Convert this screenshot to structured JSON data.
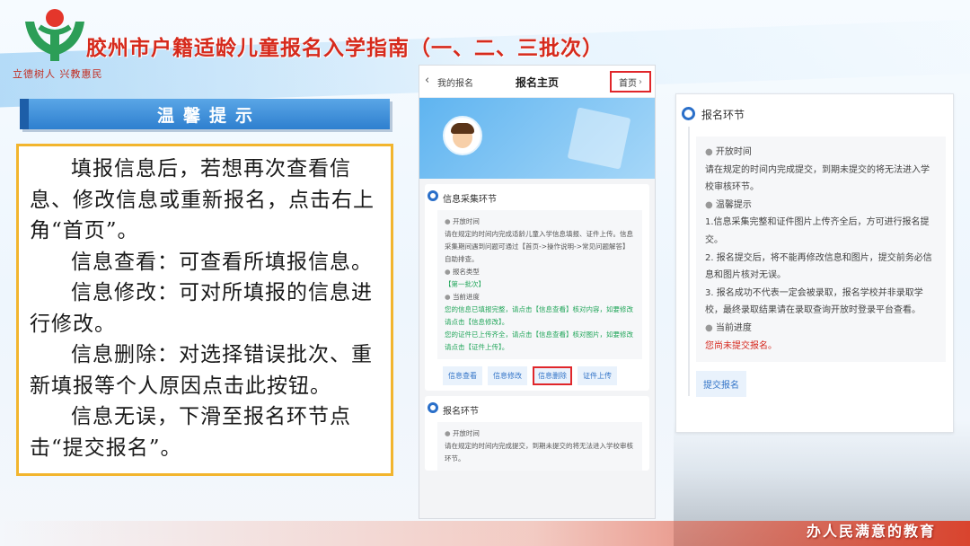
{
  "header": {
    "title": "胶州市户籍适龄儿童报名入学指南（一、二、三批次）",
    "motto": "立德树人 兴教惠民"
  },
  "tip": {
    "banner": "温馨提示",
    "paragraphs": [
      "填报信息后，若想再次查看信息、修改信息或重新报名，点击右上角“首页”。",
      "信息查看：可查看所填报信息。",
      "信息修改：可对所填报的信息进行修改。",
      "信息删除：对选择错误批次、重新填报等个人原因点击此按钮。",
      "信息无误，下滑至报名环节点击“提交报名”。"
    ]
  },
  "phone": {
    "back_label": "我的报名",
    "title": "报名主页",
    "home_button": "首页",
    "section1": {
      "title": "信息采集环节",
      "open_time_label": "开放时间",
      "open_time_text": "请在规定的时间内完成适龄儿童入学信息填报、证件上传。信息采集期间遇到问题可通过【首页->操作说明->常见问题解答】自助排查。",
      "type_label": "报名类型",
      "type_value": "【第一批次】",
      "progress_label": "当前进度",
      "progress_text1": "您的信息已填报完整，请点击【信息查看】核对内容，如要修改请点击【信息修改】。",
      "progress_text2": "您的证件已上传齐全，请点击【信息查看】核对图片，如要修改请点击【证件上传】。",
      "buttons": [
        "信息查看",
        "信息修改",
        "信息删除",
        "证件上传"
      ]
    },
    "section2": {
      "title": "报名环节",
      "open_time_label": "开放时间",
      "open_time_text": "请在规定的时间内完成提交，到期未提交的将无法进入学校审核环节。"
    }
  },
  "panel": {
    "title": "报名环节",
    "open_time_label": "开放时间",
    "open_time_text": "请在规定的时间内完成提交，到期未提交的将无法进入学校审核环节。",
    "tips_label": "温馨提示",
    "tip1": "1.信息采集完整和证件图片上传齐全后，方可进行报名提交。",
    "tip2": "2. 报名提交后，将不能再修改信息和图片，提交前务必信息和图片核对无误。",
    "tip3": "3. 报名成功不代表一定会被录取，报名学校并非录取学校，最终录取结果请在录取查询开放时登录平台查看。",
    "progress_label": "当前进度",
    "progress_value": "您尚未提交报名。",
    "submit_button": "提交报名"
  },
  "footer": {
    "slogan": "办人民满意的教育"
  },
  "colors": {
    "title_red": "#d62a1c",
    "banner_blue": "#2e7fcf",
    "box_border": "#f2b52e",
    "ring_blue": "#2a6fc9",
    "highlight_red": "#e0262a",
    "status_green": "#22a65a"
  }
}
